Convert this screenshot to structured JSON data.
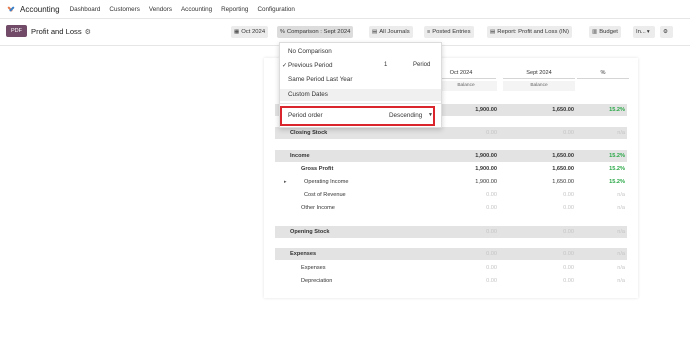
{
  "nav": {
    "app_name": "Accounting",
    "items": [
      "Dashboard",
      "Customers",
      "Vendors",
      "Accounting",
      "Reporting",
      "Configuration"
    ]
  },
  "toolbar": {
    "pdf_label": "PDF",
    "page_title": "Profit and Loss",
    "filters": [
      {
        "icon": "calendar-icon",
        "glyph": "▦",
        "label": "Oct 2024"
      },
      {
        "icon": "percent-icon",
        "glyph": "%",
        "label": "Comparison : Sept 2024"
      },
      {
        "icon": "book-icon",
        "glyph": "▤",
        "label": "All Journals"
      },
      {
        "icon": "list-icon",
        "glyph": "≡",
        "label": "Posted Entries"
      },
      {
        "icon": "book-icon",
        "glyph": "▤",
        "label": "Report: Profit and Loss (IN)"
      },
      {
        "icon": "chart-icon",
        "glyph": "▥",
        "label": "Budget"
      },
      {
        "icon": "none",
        "glyph": "",
        "label": "In..."
      },
      {
        "icon": "settings-icon",
        "glyph": "⚙",
        "label": ""
      }
    ]
  },
  "dropdown": {
    "items": [
      "No Comparison",
      "Previous Period",
      "Same Period Last Year",
      "Custom Dates"
    ],
    "checked_index": 1,
    "period_count": "1",
    "period_unit": "Period",
    "period_order_label": "Period order",
    "period_order_value": "Descending"
  },
  "report": {
    "columns": [
      "Oct 2024",
      "Sept 2024",
      "%"
    ],
    "subheaders": [
      "Balance",
      "Balance"
    ],
    "rows": [
      {
        "label": "",
        "v1": "1,900.00",
        "v2": "1,650.00",
        "v3": "15.2%",
        "style": "grey",
        "indent": 0
      },
      {
        "label": "Closing Stock",
        "v1": "0.00",
        "v2": "0.00",
        "v3": "n/a",
        "style": "grey",
        "indent": 1
      },
      {
        "label": "Income",
        "v1": "1,900.00",
        "v2": "1,650.00",
        "v3": "15.2%",
        "style": "grey",
        "indent": 1
      },
      {
        "label": "Gross Profit",
        "v1": "1,900.00",
        "v2": "1,650.00",
        "v3": "15.2%",
        "style": "bold",
        "indent": 2
      },
      {
        "label": "Operating Income",
        "v1": "1,900.00",
        "v2": "1,650.00",
        "v3": "15.2%",
        "style": "normal",
        "indent": 3
      },
      {
        "label": "Cost of Revenue",
        "v1": "0.00",
        "v2": "0.00",
        "v3": "n/a",
        "style": "muted",
        "indent": 3
      },
      {
        "label": "Other Income",
        "v1": "0.00",
        "v2": "0.00",
        "v3": "n/a",
        "style": "muted",
        "indent": 2
      },
      {
        "label": "Opening Stock",
        "v1": "0.00",
        "v2": "0.00",
        "v3": "n/a",
        "style": "grey",
        "indent": 1
      },
      {
        "label": "Expenses",
        "v1": "0.00",
        "v2": "0.00",
        "v3": "n/a",
        "style": "grey",
        "indent": 1
      },
      {
        "label": "Expenses",
        "v1": "0.00",
        "v2": "0.00",
        "v3": "n/a",
        "style": "muted",
        "indent": 2
      },
      {
        "label": "Depreciation",
        "v1": "0.00",
        "v2": "0.00",
        "v3": "n/a",
        "style": "muted",
        "indent": 2
      }
    ]
  },
  "colors": {
    "brand": "#714b67",
    "positive": "#28a745",
    "highlight": "#d9252b"
  }
}
